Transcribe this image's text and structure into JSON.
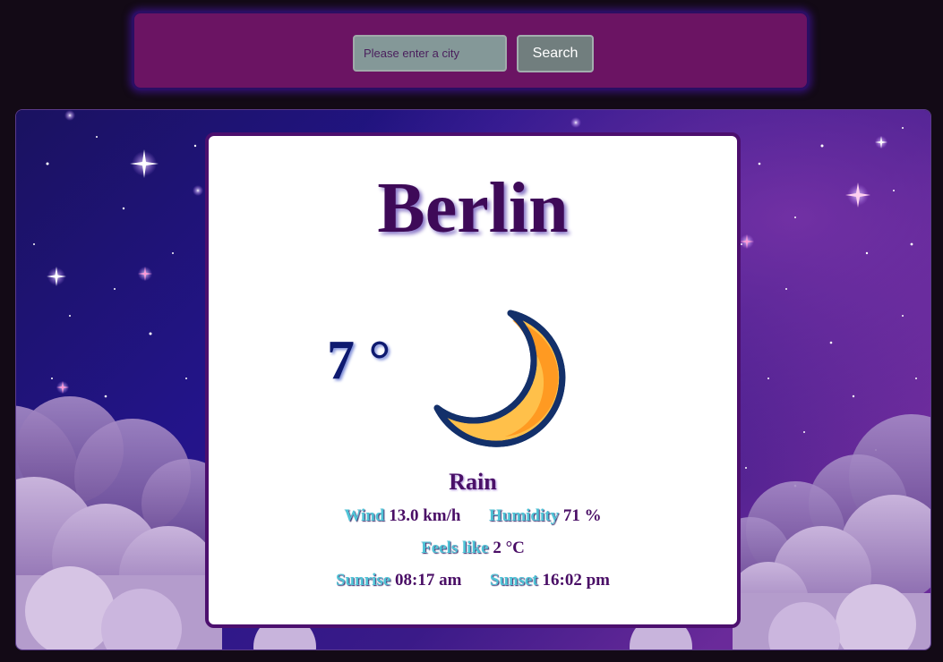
{
  "search": {
    "placeholder": "Please enter a city",
    "button_label": "Search"
  },
  "weather": {
    "city": "Berlin",
    "temperature": "7 °",
    "condition": "Rain",
    "icon": "crescent-moon-icon",
    "wind_label": "Wind",
    "wind_value": "13.0 km/h",
    "humidity_label": "Humidity",
    "humidity_value": "71 %",
    "feels_like_label": "Feels like",
    "feels_like_value": "2 °C",
    "sunrise_label": "Sunrise",
    "sunrise_value": "08:17 am",
    "sunset_label": "Sunset",
    "sunset_value": "16:02 pm"
  },
  "colors": {
    "page_background": "#130a16",
    "search_bar": "#6b1463",
    "card_border": "#4c0f6e",
    "label_accent": "#4fc3d6",
    "city_text": "#3e0a58"
  }
}
